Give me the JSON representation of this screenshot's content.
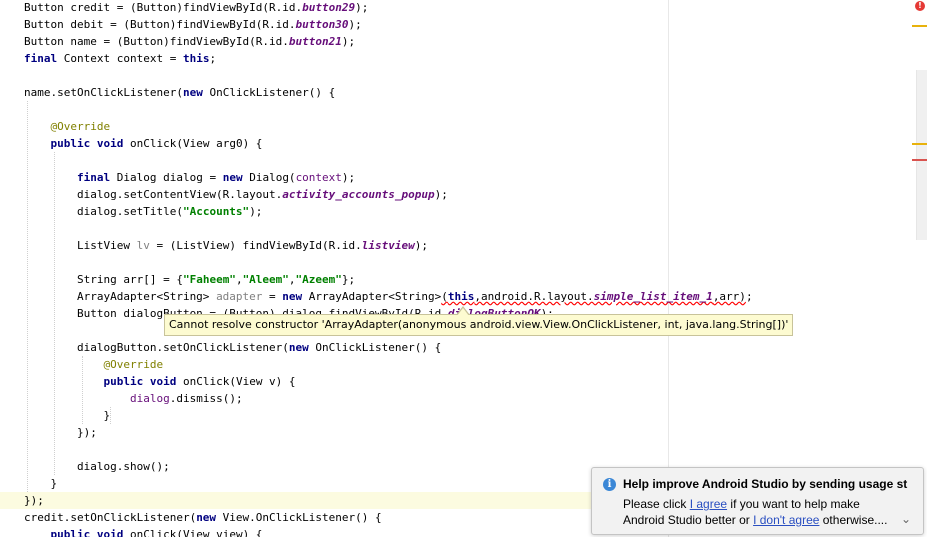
{
  "editor": {
    "lines": [
      [
        {
          "t": "Button credit = (Button)findViewById(R.id."
        },
        {
          "t": "button29",
          "c": "fld"
        },
        {
          "t": ");"
        }
      ],
      [
        {
          "t": "Button debit = (Button)findViewById(R.id."
        },
        {
          "t": "button30",
          "c": "fld"
        },
        {
          "t": ");"
        }
      ],
      [
        {
          "t": "Button name = (Button)findViewById(R.id."
        },
        {
          "t": "button21",
          "c": "fld"
        },
        {
          "t": ");"
        }
      ],
      [
        {
          "t": "final",
          "c": "kw"
        },
        {
          "t": " Context context = "
        },
        {
          "t": "this",
          "c": "kw"
        },
        {
          "t": ";"
        }
      ],
      [],
      [
        {
          "t": "name.setOnClickListener("
        },
        {
          "t": "new",
          "c": "kw"
        },
        {
          "t": " OnClickListener() {"
        }
      ],
      [],
      [
        {
          "t": "    "
        },
        {
          "t": "@Override",
          "c": "ann"
        }
      ],
      [
        {
          "t": "    "
        },
        {
          "t": "public void",
          "c": "kw"
        },
        {
          "t": " onClick(View arg0) {"
        }
      ],
      [],
      [
        {
          "t": "        "
        },
        {
          "t": "final",
          "c": "kw"
        },
        {
          "t": " Dialog dialog = "
        },
        {
          "t": "new",
          "c": "kw"
        },
        {
          "t": " Dialog("
        },
        {
          "t": "context",
          "c": "fldn"
        },
        {
          "t": ");"
        }
      ],
      [
        {
          "t": "        dialog.setContentView(R.layout."
        },
        {
          "t": "activity_accounts_popup",
          "c": "fld"
        },
        {
          "t": ");"
        }
      ],
      [
        {
          "t": "        dialog.setTitle("
        },
        {
          "t": "\"Accounts\"",
          "c": "str"
        },
        {
          "t": ");"
        }
      ],
      [],
      [
        {
          "t": "        ListView "
        },
        {
          "t": "lv",
          "c": "gry"
        },
        {
          "t": " = (ListView) findViewById(R.id."
        },
        {
          "t": "listview",
          "c": "fld"
        },
        {
          "t": ");"
        }
      ],
      [],
      [
        {
          "t": "        String arr[] = {"
        },
        {
          "t": "\"Faheem\"",
          "c": "str"
        },
        {
          "t": ","
        },
        {
          "t": "\"Aleem\"",
          "c": "str"
        },
        {
          "t": ","
        },
        {
          "t": "\"Azeem\"",
          "c": "str"
        },
        {
          "t": "};"
        }
      ],
      [
        {
          "t": "        ArrayAdapter<String> "
        },
        {
          "t": "adapter",
          "c": "gry"
        },
        {
          "t": " = "
        },
        {
          "t": "new",
          "c": "kw"
        },
        {
          "t": " ArrayAdapter<String>"
        },
        {
          "t": "(",
          "c": "err"
        },
        {
          "t": "this",
          "c": "kw err"
        },
        {
          "t": ",android.R.layout.",
          "c": "err"
        },
        {
          "t": "simple_list_item_1",
          "c": "fld err"
        },
        {
          "t": ",arr)",
          "c": "err"
        },
        {
          "t": ";"
        }
      ],
      [
        {
          "t": "        Button dialogButton = (Button) dialog.findViewById(R.id."
        },
        {
          "t": "dialogButtonOK",
          "c": "fld"
        },
        {
          "t": ");"
        }
      ],
      [],
      [
        {
          "t": "        dialogButton.setOnClickListener("
        },
        {
          "t": "new",
          "c": "kw"
        },
        {
          "t": " OnClickListener() {"
        }
      ],
      [
        {
          "t": "            "
        },
        {
          "t": "@Override",
          "c": "ann"
        }
      ],
      [
        {
          "t": "            "
        },
        {
          "t": "public void",
          "c": "kw"
        },
        {
          "t": " onClick(View v) {"
        }
      ],
      [
        {
          "t": "                "
        },
        {
          "t": "dialog",
          "c": "fldn"
        },
        {
          "t": ".dismiss();"
        }
      ],
      [
        {
          "t": "            }"
        }
      ],
      [
        {
          "t": "        });"
        }
      ],
      [],
      [
        {
          "t": "        dialog.show();"
        }
      ],
      [
        {
          "t": "    }"
        }
      ],
      [
        {
          "t": "});"
        }
      ],
      [
        {
          "t": "credit.setOnClickListener("
        },
        {
          "t": "new",
          "c": "kw"
        },
        {
          "t": " View.OnClickListener() {"
        }
      ],
      [
        {
          "t": "    "
        },
        {
          "t": "public void",
          "c": "kw"
        },
        {
          "t": " onClick(View view) {"
        }
      ]
    ]
  },
  "tooltip": {
    "text": "Cannot resolve constructor 'ArrayAdapter(anonymous android.view.View.OnClickListener, int, java.lang.String[])'"
  },
  "notification": {
    "icon": "info-icon",
    "title": "Help improve Android Studio by sending usage st",
    "line1_prefix": "Please click ",
    "link_agree": "I agree",
    "line1_suffix": " if you want to help make",
    "line2_prefix": "Android Studio better or ",
    "link_disagree": "I don't agree",
    "line2_suffix": " otherwise....",
    "expand_icon": "chevron-down-icon"
  },
  "error_stripe": {
    "error_icon": "error-icon",
    "error_glyph": "!",
    "warning_color": "#e8b20c",
    "error_color": "#d9534f"
  }
}
